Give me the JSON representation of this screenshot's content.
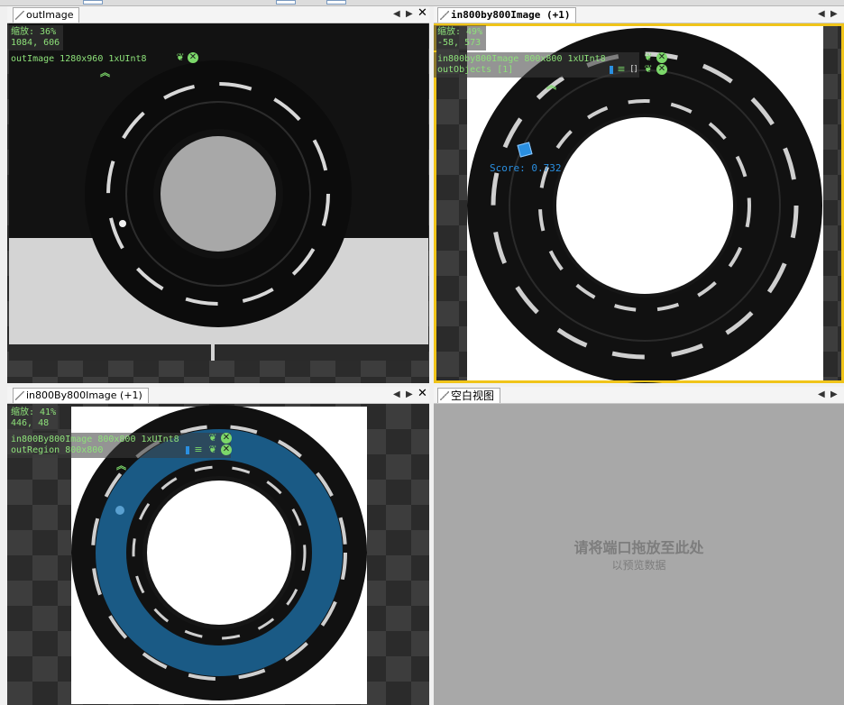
{
  "panes": {
    "top_left": {
      "tab": "outImage",
      "zoom_line": "缩放: 36%",
      "coord_line": "1084, 606",
      "output_line": "outImage 1280x960 1xUInt8"
    },
    "top_right": {
      "tab": "in800by800Image (+1)",
      "zoom_line": "缩放: 49%",
      "coord_line": "-58, 573",
      "output_line": "in800by800Image 800x800 1xUInt8",
      "objects_line": "outObjects [1]",
      "score_text": "Score: 0.732",
      "active_border_color": "#f0c419"
    },
    "bottom_left": {
      "tab": "in800By800Image (+1)",
      "zoom_line": "缩放: 41%",
      "coord_line": "446, 48",
      "output_line": "in800By800Image 800x800 1xUInt8",
      "region_line": "outRegion 800x800",
      "region_color": "#1a5a85"
    },
    "bottom_right": {
      "tab": "空白视图",
      "empty_title": "请将端口拖放至此处",
      "empty_subtitle": "以预览数据"
    }
  },
  "controls": {
    "prev": "◀",
    "next": "▶",
    "close": "✕"
  },
  "icons": {
    "leaf": "leaf-icon",
    "circle_x": "circle-x-icon",
    "chevron": "double-chevron-up-icon",
    "list": "list-icon",
    "bracket": "bracket-icon",
    "marker": "blue-bar-icon"
  },
  "colors": {
    "overlay_text": "#8ee27a",
    "empty_bg": "#a8a8a8",
    "empty_text": "#7d7d7d"
  }
}
